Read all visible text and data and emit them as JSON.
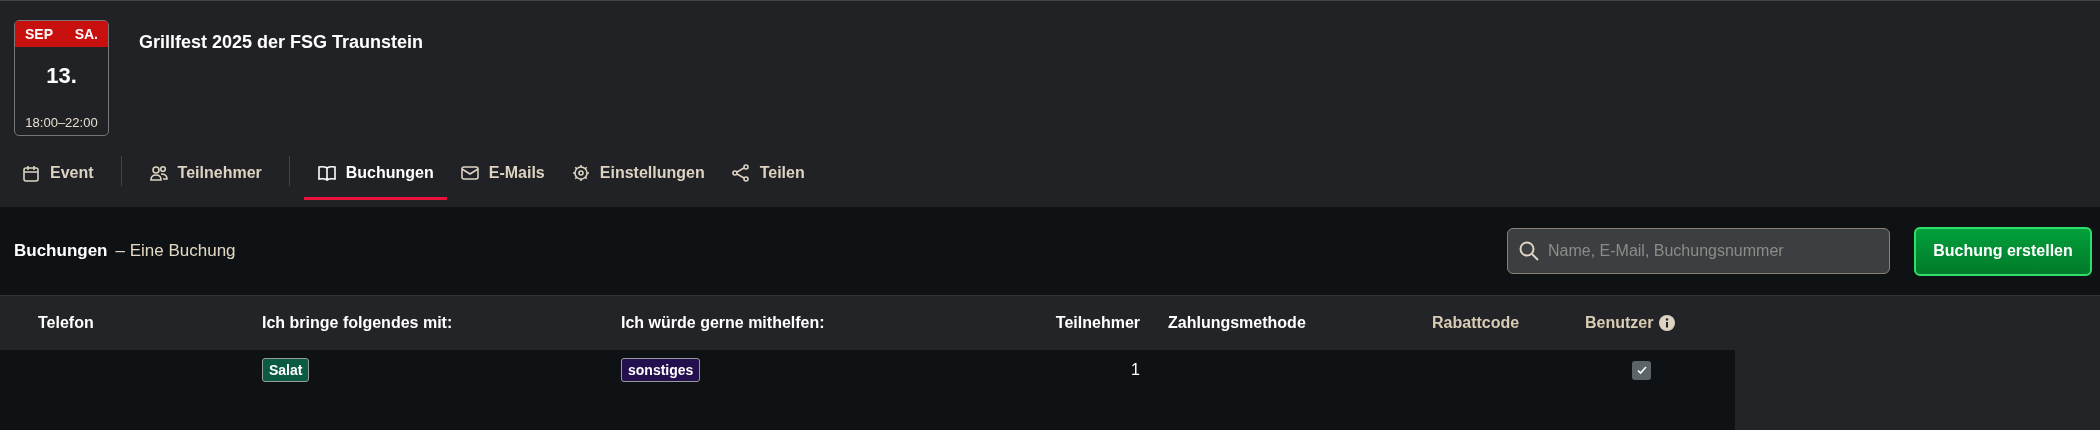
{
  "event": {
    "date_badge": {
      "month": "SEP",
      "weekday": "SA.",
      "day": "13.",
      "time": "18:00–22:00"
    },
    "title": "Grillfest 2025 der FSG Traunstein"
  },
  "tabs": [
    {
      "label": "Event",
      "selected": false,
      "divider_after": true
    },
    {
      "label": "Teilnehmer",
      "selected": false,
      "divider_after": true
    },
    {
      "label": "Buchungen",
      "selected": true,
      "divider_after": false
    },
    {
      "label": "E-Mails",
      "selected": false,
      "divider_after": false
    },
    {
      "label": "Einstellungen",
      "selected": false,
      "divider_after": false
    },
    {
      "label": "Teilen",
      "selected": false,
      "divider_after": false
    }
  ],
  "toolbar": {
    "heading": "Buchungen",
    "subheading": "– Eine Buchung",
    "search": {
      "placeholder": "Name, E-Mail, Buchungsnummer"
    },
    "create_button": "Buchung erstellen"
  },
  "table": {
    "columns": [
      {
        "label": "Telefon",
        "muted": false,
        "info": false
      },
      {
        "label": "Ich bringe folgendes mit:",
        "muted": false,
        "info": false
      },
      {
        "label": "Ich würde gerne mithelfen:",
        "muted": false,
        "info": false
      },
      {
        "label": "Teilnehmer",
        "muted": false,
        "info": false
      },
      {
        "label": "Zahlungsmethode",
        "muted": false,
        "info": false
      },
      {
        "label": "Rabattcode",
        "muted": true,
        "info": false
      },
      {
        "label": "Benutzer",
        "muted": true,
        "info": true
      }
    ],
    "rows": [
      {
        "cells": [
          {
            "kind": "empty"
          },
          {
            "kind": "tag",
            "text": "Salat",
            "color": "#0b5a43"
          },
          {
            "kind": "tag",
            "text": "sonstiges",
            "color": "#25104f"
          },
          {
            "kind": "number",
            "text": "1"
          },
          {
            "kind": "empty"
          },
          {
            "kind": "empty"
          },
          {
            "kind": "check",
            "checked": true
          }
        ]
      }
    ]
  }
}
